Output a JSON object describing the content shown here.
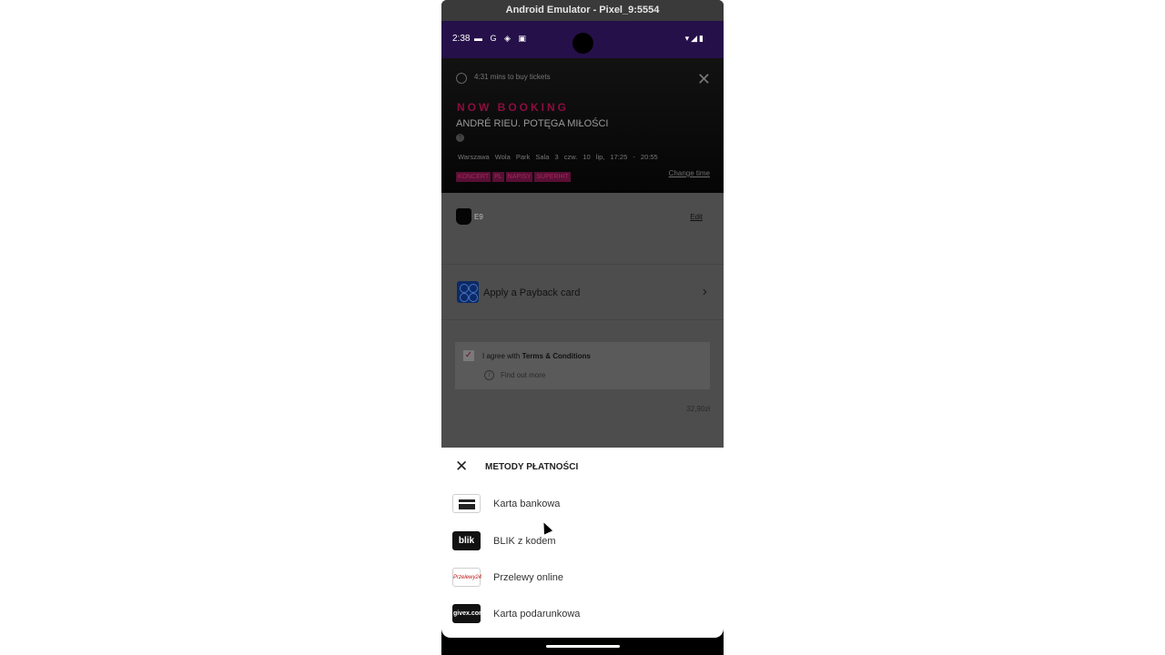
{
  "window": {
    "title": "Android Emulator - Pixel_9:5554"
  },
  "statusbar": {
    "time": "2:38",
    "left_icons": "▬ G ◈ ▣",
    "right_icons": "▾◢▮"
  },
  "booking": {
    "timer": "4:31 mins to buy tickets",
    "now_booking": "NOW BOOKING",
    "title": "ANDRÉ RIEU. POTĘGA MIŁOŚCI",
    "help": "?",
    "details": "Warszawa Wola Park   Sala 3   czw. 10 lip, 17:25 - 20:55",
    "tags": [
      "KONCERT",
      "PL",
      "NAPISY",
      "SUPERHIT"
    ],
    "change_time": "Change time"
  },
  "seat": {
    "label": "E9",
    "edit": "Edit"
  },
  "payback": {
    "label": "Apply a Payback card"
  },
  "terms": {
    "check": "✓",
    "prefix": "I agree with ",
    "link": "Terms & Conditions",
    "info": "i",
    "find_out": "Find out more"
  },
  "price": "32,90zł",
  "sheet": {
    "close": "✕",
    "title": "METODY PŁATNOŚCI",
    "methods": [
      {
        "label": "Karta bankowa",
        "icon": "card-icon"
      },
      {
        "label": "BLIK z kodem",
        "icon": "blik-icon",
        "badge": "blik"
      },
      {
        "label": "Przelewy online",
        "icon": "przelewy24-icon",
        "badge": "Przelewy24"
      },
      {
        "label": "Karta podarunkowa",
        "icon": "givex-icon",
        "badge": "givex.com"
      }
    ]
  },
  "colors": {
    "accent": "#8c0d3f",
    "status_bar": "#26104a",
    "overlay": "#4d4d4d"
  }
}
